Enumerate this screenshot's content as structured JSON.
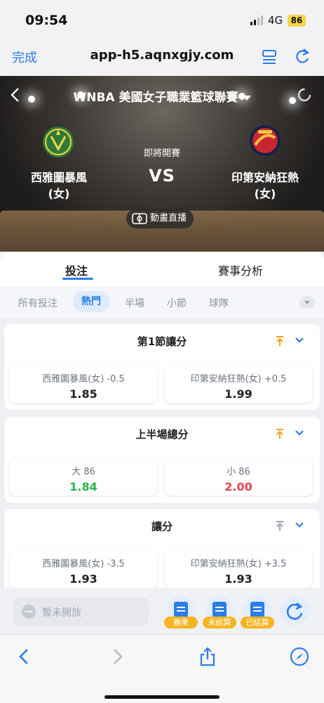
{
  "status_bar": {
    "time": "09:54",
    "network": "4G",
    "battery": "86"
  },
  "browser": {
    "done_label": "完成",
    "url": "app-h5.aqnxgjy.com",
    "list_icon": "list-icon",
    "reload_icon": "reload-icon"
  },
  "match": {
    "league": "WNBA 美國女子職業籃球聯賽",
    "status": "即將開賽",
    "vs": "VS",
    "home": {
      "name": "西雅圖暴風",
      "suffix": "(女)",
      "logo_color": "#2f7a3a"
    },
    "away": {
      "name": "印第安納狂熱",
      "suffix": "(女)",
      "logo_color": "#c9262f"
    },
    "live_label": "動畫直播"
  },
  "tabs": {
    "bet": "投注",
    "analysis": "賽事分析"
  },
  "sub_tabs": [
    "所有投注",
    "熱門",
    "半場",
    "小節",
    "球隊"
  ],
  "sub_tab_active": "熱門",
  "markets": [
    {
      "title": "第1節讓分",
      "home": {
        "label": "西雅圖暴風(女) -0.5",
        "odds": "1.85",
        "trend": "none"
      },
      "away": {
        "label": "印第安納狂熱(女) +0.5",
        "odds": "1.99",
        "trend": "none"
      },
      "pinned": true
    },
    {
      "title": "上半場總分",
      "home": {
        "label": "大 86",
        "odds": "1.84",
        "trend": "up"
      },
      "away": {
        "label": "小 86",
        "odds": "2.00",
        "trend": "down"
      },
      "pinned": true
    },
    {
      "title": "讓分",
      "home": {
        "label": "西雅圖暴風(女) -3.5",
        "odds": "1.93",
        "trend": "none"
      },
      "away": {
        "label": "印第安納狂熱(女) +3.5",
        "odds": "1.93",
        "trend": "none"
      },
      "pinned": false
    }
  ],
  "bet_bar": {
    "placeholder": "暫未開放",
    "records": [
      "賽果",
      "未結算",
      "已結算"
    ]
  },
  "colors": {
    "accent": "#2b7de9",
    "up": "#2bb24a",
    "down": "#e0464e",
    "pin_active": "#f0a020",
    "badge": "#f6b521"
  }
}
